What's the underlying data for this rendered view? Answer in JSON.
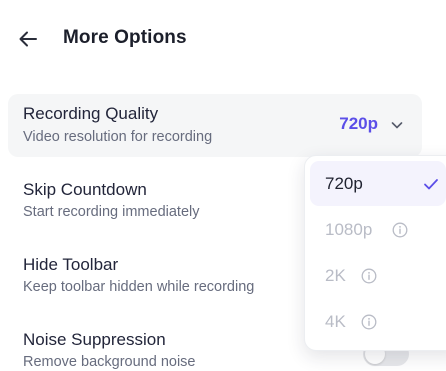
{
  "header": {
    "title": "More Options",
    "back_icon": "arrow-left-icon"
  },
  "settings": {
    "recording_quality": {
      "label": "Recording Quality",
      "description": "Video resolution for recording",
      "value": "720p"
    },
    "skip_countdown": {
      "label": "Skip Countdown",
      "description": "Start recording immediately"
    },
    "hide_toolbar": {
      "label": "Hide Toolbar",
      "description": "Keep toolbar hidden while recording"
    },
    "noise_suppression": {
      "label": "Noise Suppression",
      "description": "Remove background noise",
      "enabled": false
    }
  },
  "dropdown": {
    "options": [
      {
        "label": "720p",
        "selected": true,
        "disabled": false
      },
      {
        "label": "1080p",
        "selected": false,
        "disabled": true
      },
      {
        "label": "2K",
        "selected": false,
        "disabled": true
      },
      {
        "label": "4K",
        "selected": false,
        "disabled": true
      }
    ]
  },
  "colors": {
    "accent": "#5b4ee8",
    "selected_bg": "#f4f3fd",
    "row_bg": "#f5f6f7",
    "disabled_text": "#b9bcc6"
  }
}
